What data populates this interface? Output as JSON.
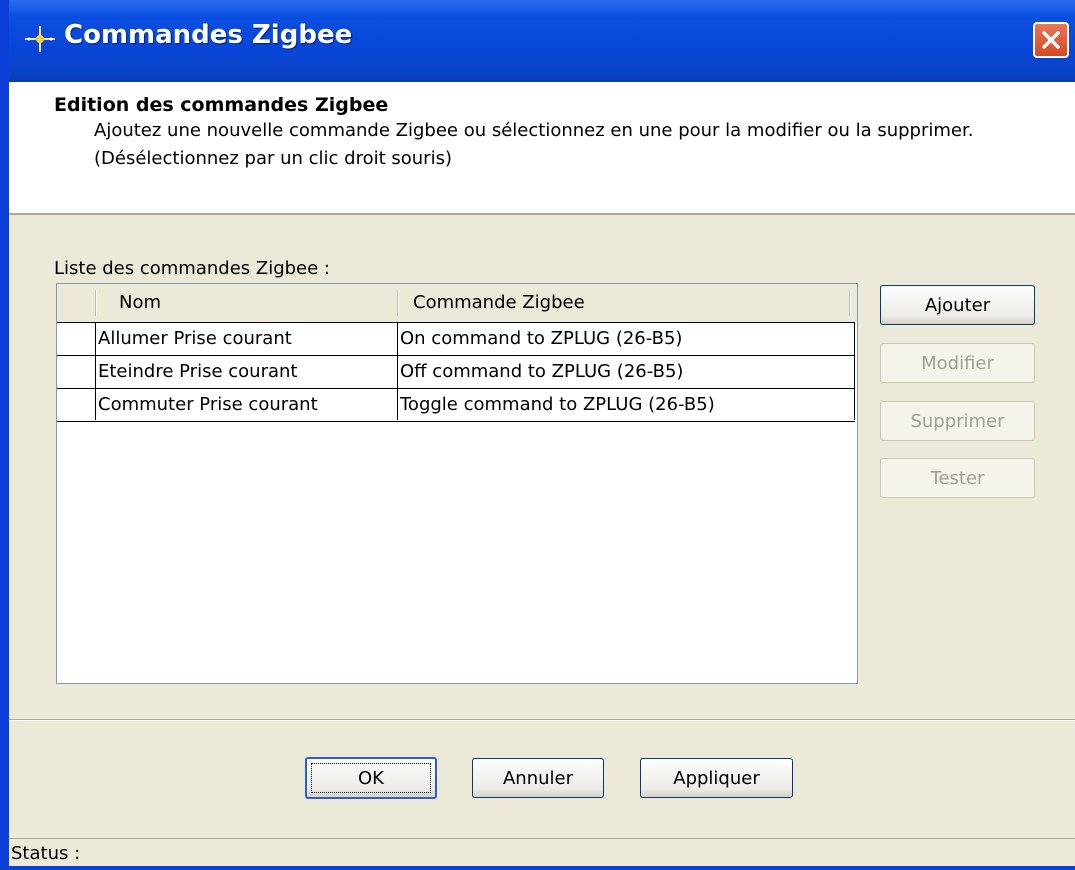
{
  "window": {
    "title": "Commandes Zigbee",
    "icon": "zigbee-sparkle-icon",
    "close_icon": "close-icon"
  },
  "header": {
    "title": "Edition des commandes Zigbee",
    "description": "Ajoutez une nouvelle commande Zigbee ou sélectionnez en une pour la modifier ou la supprimer.",
    "hint": "(Désélectionnez par un clic droit souris)"
  },
  "list": {
    "label": "Liste des commandes Zigbee :",
    "columns": [
      "Nom",
      "Commande Zigbee"
    ],
    "rows": [
      {
        "nom": "Allumer Prise courant",
        "commande": "On command to ZPLUG (26-B5)"
      },
      {
        "nom": "Eteindre Prise courant",
        "commande": "Off command to ZPLUG (26-B5)"
      },
      {
        "nom": "Commuter Prise courant",
        "commande": "Toggle command to ZPLUG (26-B5)"
      }
    ]
  },
  "side_buttons": {
    "add": "Ajouter",
    "edit": "Modifier",
    "delete": "Supprimer",
    "test": "Tester"
  },
  "footer_buttons": {
    "ok": "OK",
    "cancel": "Annuler",
    "apply": "Appliquer"
  },
  "status": {
    "label": "Status :"
  },
  "colors": {
    "titlebar": "#0846d8",
    "dialog_bg": "#ece9d8",
    "close_button": "#d24a22",
    "disabled_text": "#a09f95"
  }
}
